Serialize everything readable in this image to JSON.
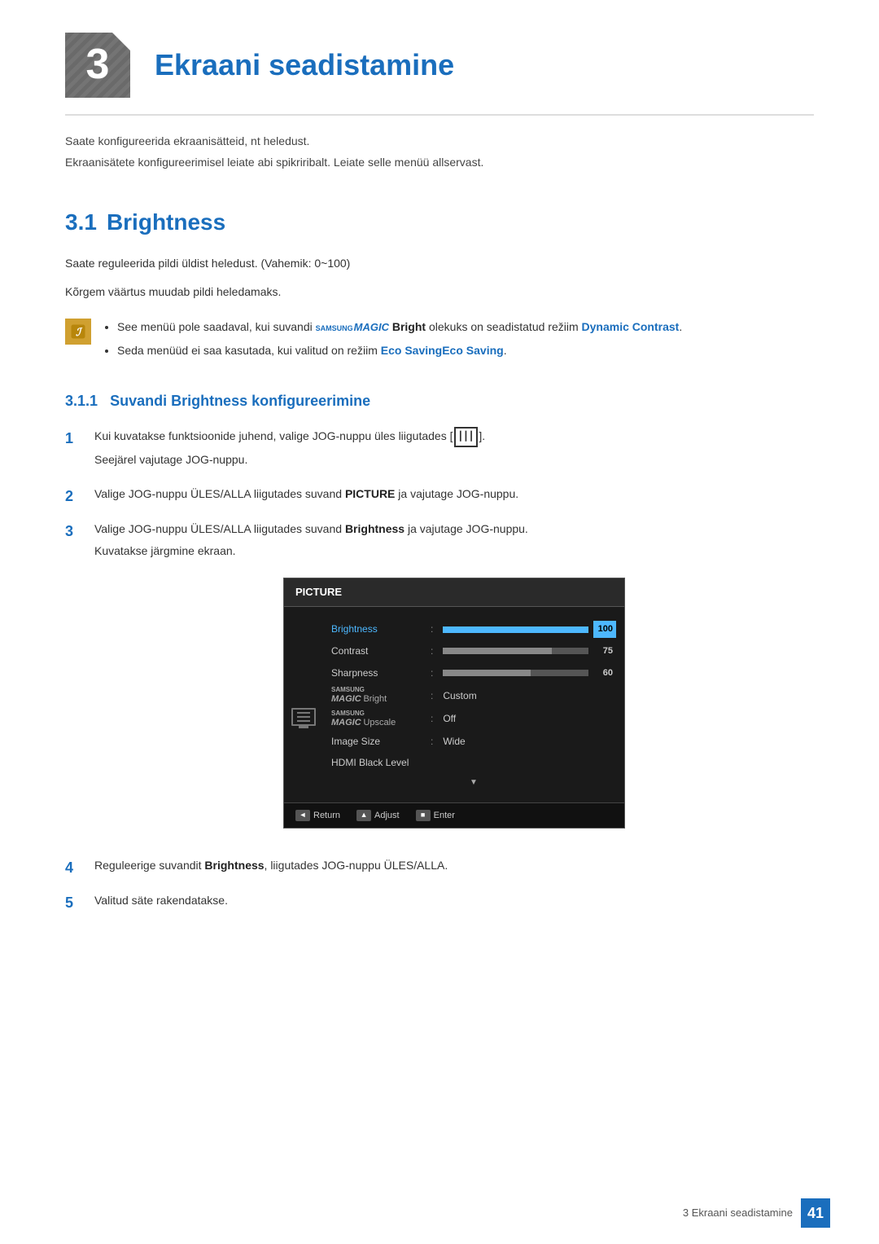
{
  "chapter": {
    "number": "3",
    "title": "Ekraani seadistamine",
    "desc1": "Saate konfigureerida ekraanisätteid, nt heledust.",
    "desc2": "Ekraanisätete konfigureerimisel leiate abi spikriribalt. Leiate selle menüü allservast."
  },
  "section31": {
    "number": "3.1",
    "title": "Brightness",
    "body1": "Saate reguleerida pildi üldist heledust. (Vahemik: 0~100)",
    "body2": "Kõrgem väärtus muudab pildi heledamaks.",
    "note1": "See menüü pole saadaval, kui suvandi",
    "samsung_magic": "SAMSUNG MAGIC",
    "bright": "Bright",
    "note1_mid": "olekuks on seadistatud režiim",
    "dynamic_contrast": "Dynamic Contrast",
    "note1_end": ".",
    "note2_start": "Seda menüüd ei saa kasutada, kui valitud on režiim",
    "eco_saving": "Eco Saving",
    "note2_end": "."
  },
  "subsection311": {
    "number": "3.1.1",
    "title": "Suvandi Brightness konfigureerimine"
  },
  "steps": [
    {
      "num": "1",
      "text1": "Kui kuvatakse funktsioonide juhend, valige JOG-nuppu üles liigutades [",
      "jog": "|||",
      "text2": "].",
      "text3": "Seejärel vajutage JOG-nuppu."
    },
    {
      "num": "2",
      "text": "Valige JOG-nuppu ÜLES/ALLA liigutades suvand",
      "bold": "PICTURE",
      "text2": "ja vajutage JOG-nuppu."
    },
    {
      "num": "3",
      "text": "Valige JOG-nuppu ÜLES/ALLA liigutades suvand",
      "bold": "Brightness",
      "text2": "ja vajutage JOG-nuppu.",
      "text3": "Kuvatakse järgmine ekraan."
    },
    {
      "num": "4",
      "text": "Reguleerige suvandit",
      "bold": "Brightness",
      "text2": ", liigutades JOG-nuppu ÜLES/ALLA."
    },
    {
      "num": "5",
      "text": "Valitud säte rakendatakse."
    }
  ],
  "osd": {
    "title": "PICTURE",
    "rows": [
      {
        "label": "Brightness",
        "type": "bar",
        "fill": 100,
        "value": "100",
        "highlighted": true
      },
      {
        "label": "Contrast",
        "type": "bar",
        "fill": 75,
        "value": "75",
        "highlighted": false
      },
      {
        "label": "Sharpness",
        "type": "bar",
        "fill": 60,
        "value": "60",
        "highlighted": false
      },
      {
        "label": "SAMSUNG MAGIC Bright",
        "type": "text",
        "value": "Custom",
        "highlighted": false
      },
      {
        "label": "SAMSUNG MAGIC Upscale",
        "type": "text",
        "value": "Off",
        "highlighted": false
      },
      {
        "label": "Image Size",
        "type": "text",
        "value": "Wide",
        "highlighted": false
      },
      {
        "label": "HDMI Black Level",
        "type": "empty",
        "value": "",
        "highlighted": false
      }
    ],
    "footer": [
      {
        "icon": "◄",
        "label": "Return"
      },
      {
        "icon": "▲",
        "label": "Adjust"
      },
      {
        "icon": "■",
        "label": "Enter"
      }
    ]
  },
  "footer": {
    "chapter_ref": "3 Ekraani seadistamine",
    "page_number": "41"
  }
}
